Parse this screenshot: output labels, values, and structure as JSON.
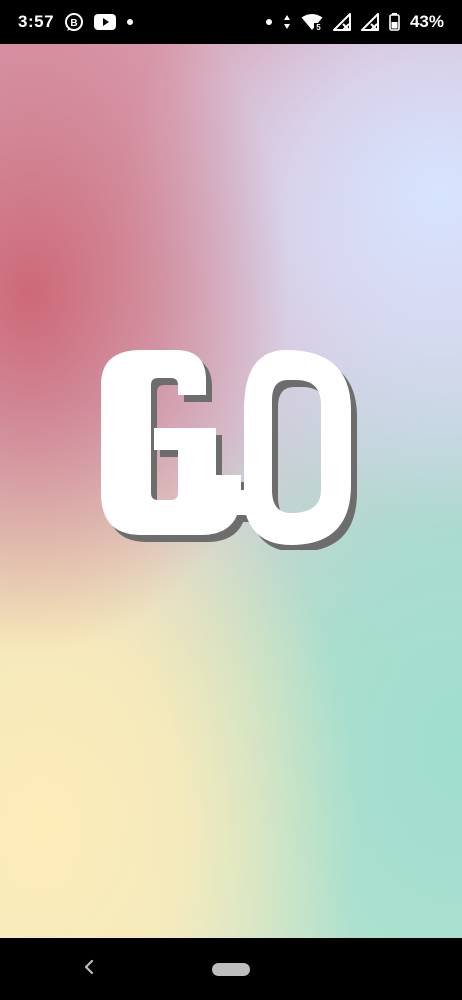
{
  "status_bar": {
    "time": "3:57",
    "left_icons": [
      "business-messaging-icon",
      "youtube-icon",
      "notification-dot-icon"
    ],
    "right_icons": [
      "notification-dot-icon",
      "data-arrows-icon",
      "wifi-icon",
      "signal-no-service-icon",
      "signal-no-service-icon",
      "battery-icon"
    ],
    "wifi_badge": "5",
    "battery_percent": "43%"
  },
  "splash": {
    "logo_name": "go-logo",
    "colors": {
      "rose": "#cd6473",
      "periwinkle": "#d7e4ff",
      "cream": "#feecb9",
      "mint": "#a0ded0",
      "logo_fill": "#ffffff",
      "logo_shadow": "#6d6d6d"
    }
  },
  "nav_bar": {
    "back_icon": "back-chevron-icon",
    "home_icon": "home-pill"
  }
}
